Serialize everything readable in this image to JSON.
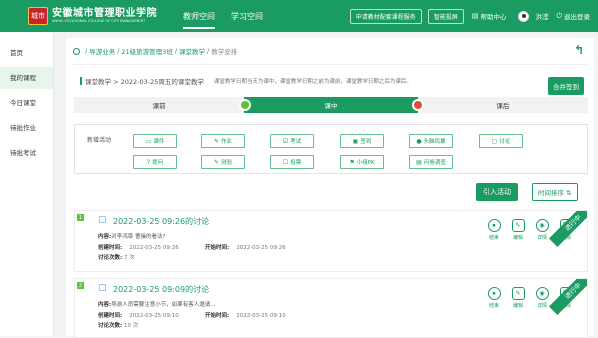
{
  "header": {
    "logo_badge": "城市",
    "logo_cn": "安徽城市管理职业学院",
    "logo_en": "ANHUI VOCATIONAL COLLEGE OF CITY MANAGEMENT",
    "nav": [
      "教师空间",
      "学习空间"
    ],
    "btn_apply": "申请教材配套课程服务",
    "btn_feedback": "智能投屏",
    "help": "帮助中心",
    "user": "洪滢",
    "logout": "退出登录"
  },
  "sidebar": {
    "items": [
      "首页",
      "我的课程",
      "今日课堂",
      "待批作业",
      "待批考试"
    ]
  },
  "breadcrumb": {
    "items": [
      "导游业务",
      "21级旅游管理3班",
      "课堂教学",
      "教学安排"
    ]
  },
  "subtitle": {
    "text": "课堂教学 > 2022-03-25周五的课堂教学",
    "note": "课堂教学日期当天为课中，课堂教学日期之前为课前，课堂教学日期之后为课后。"
  },
  "merge_btn": "合并签到",
  "stages": [
    "课前",
    "课中",
    "课后"
  ],
  "activities": {
    "label": "新增活动",
    "row1": [
      "课件",
      "作业",
      "考试",
      "签到",
      "头脑风暴",
      "讨论"
    ],
    "row2": [
      "提问",
      "测验",
      "投票",
      "小组PK",
      "问卷调查"
    ]
  },
  "intro_btn": "引入活动",
  "sort_btn": "时间排序",
  "ops": [
    "结束",
    "编辑",
    "详情",
    "删除"
  ],
  "status": "进行中",
  "cards": [
    {
      "num": "1",
      "title": "2022-03-25 09:26的讨论",
      "content_label": "内容:",
      "content": "对李鸿章 曹操的看法?",
      "created_label": "创建时间:",
      "created": "2022-03-25 09:26",
      "start_label": "开始时间:",
      "start": "2022-03-25 09:26",
      "count_label": "讨论次数:",
      "count": "7 次"
    },
    {
      "num": "2",
      "title": "2022-03-25 09:09的讨论",
      "content_label": "内容:",
      "content": "导游人员需要注意小节，如果有客人邀请...",
      "created_label": "创建时间:",
      "created": "2022-03-25 09:10",
      "start_label": "开始时间:",
      "start": "2022-03-25 09:10",
      "count_label": "讨论次数:",
      "count": "10 次"
    }
  ]
}
